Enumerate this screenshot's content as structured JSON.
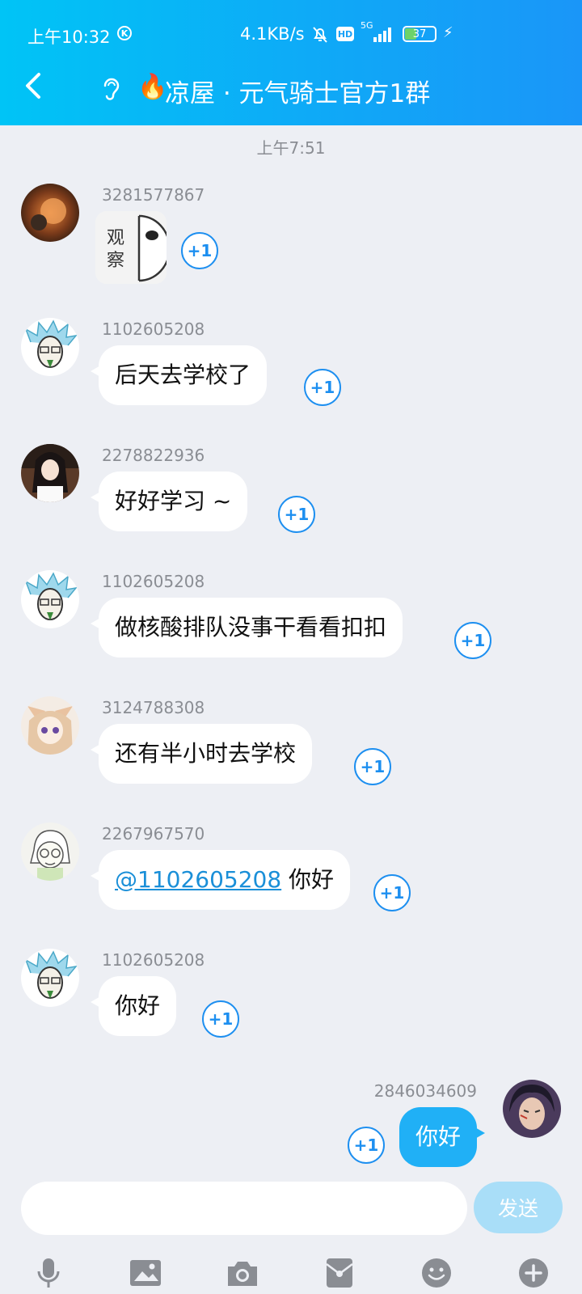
{
  "status_bar": {
    "time": "上午10:32",
    "k_badge": "K",
    "net_speed": "4.1KB/s",
    "hd": "HD",
    "network": "5G",
    "battery": "37"
  },
  "header": {
    "title": "凉屋 · 元气骑士官方1群"
  },
  "chat": {
    "time_label": "上午7:51",
    "plus_one": "+1",
    "messages": [
      {
        "sender": "3281577867",
        "type": "sticker",
        "sticker_text": "观察"
      },
      {
        "sender": "1102605208",
        "text": "后天去学校了"
      },
      {
        "sender": "2278822936",
        "text": "好好学习 ~"
      },
      {
        "sender": "1102605208",
        "text": "做核酸排队没事干看看扣扣"
      },
      {
        "sender": "3124788308",
        "text": "还有半小时去学校"
      },
      {
        "sender": "2267967570",
        "mention": "@1102605208",
        "text": " 你好"
      },
      {
        "sender": "1102605208",
        "text": "你好"
      },
      {
        "sender": "2846034609",
        "text": "你好",
        "mine": true
      }
    ]
  },
  "input": {
    "placeholder": "",
    "send_label": "发送"
  },
  "colors": {
    "accent": "#1aa2f7",
    "my_bubble": "#20b0f6",
    "background": "#edeff4"
  }
}
